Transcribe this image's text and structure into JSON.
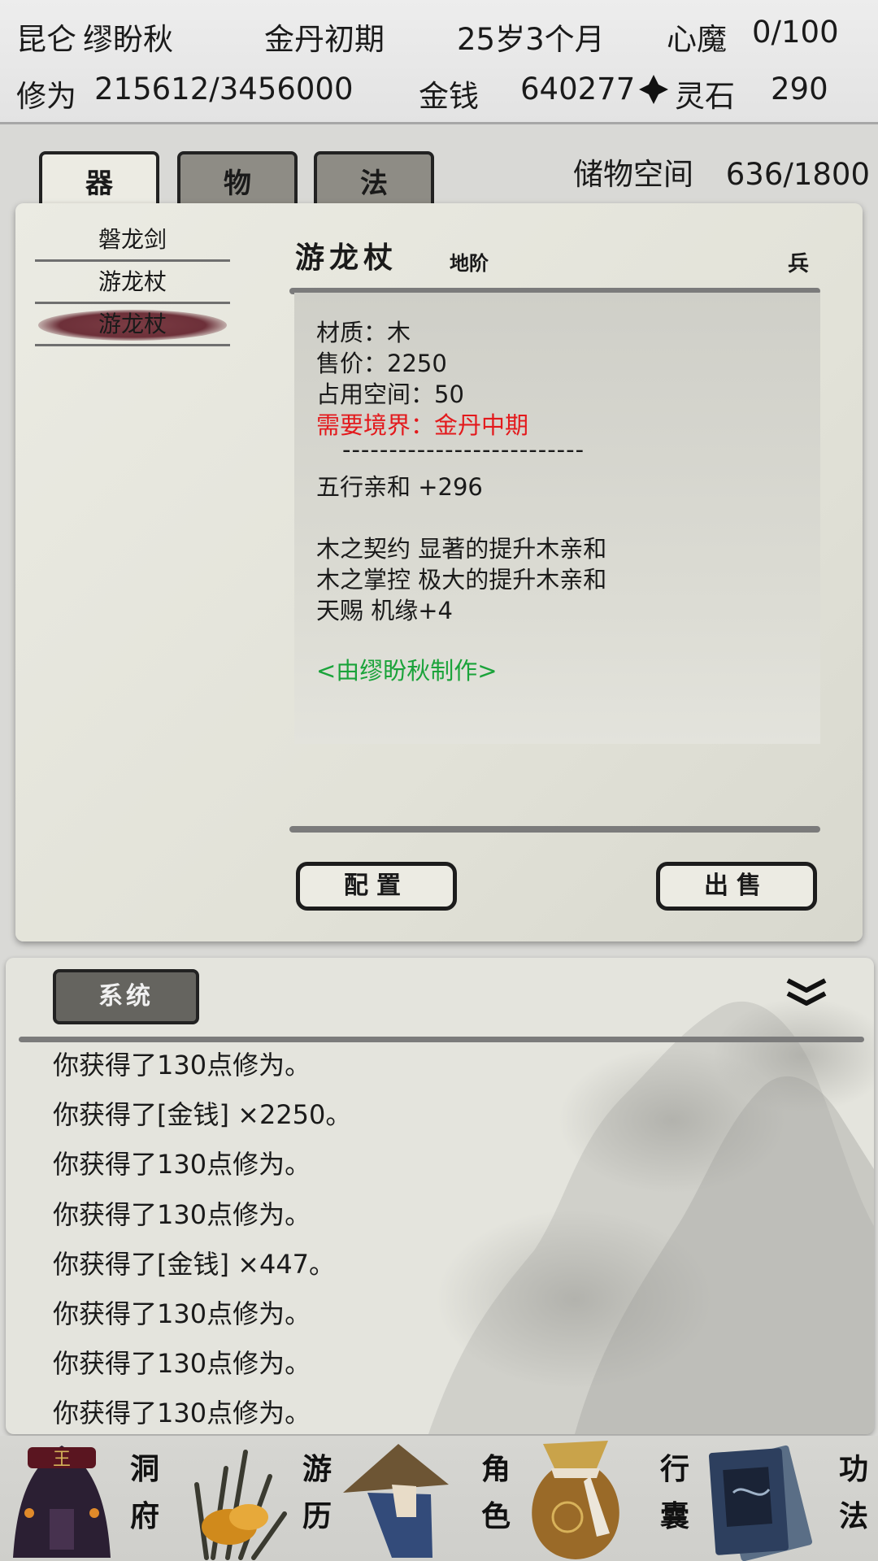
{
  "status": {
    "sect": "昆仑",
    "name": "缪盼秋",
    "realm": "金丹初期",
    "age": "25岁3个月",
    "heart_demon_label": "心魔",
    "heart_demon_value": "0/100",
    "cultivation_label": "修为",
    "cultivation_value": "215612/3456000",
    "money_label": "金钱",
    "money_value": "640277",
    "spirit_stone_label": "灵石",
    "spirit_stone_value": "290"
  },
  "bag": {
    "tabs": [
      "器",
      "物",
      "法"
    ],
    "active_tab": 0,
    "storage_label": "储物空间",
    "storage_value": "636/1800",
    "items": [
      "磐龙剑",
      "游龙杖",
      "游龙杖"
    ],
    "selected_item": 2
  },
  "detail": {
    "name": "游龙杖",
    "grade": "地阶",
    "type": "兵",
    "material": "材质：木",
    "price": "售价：2250",
    "space": "占用空间：50",
    "requirement": "需要境界：金丹中期",
    "divider": "--------------------------",
    "stat": "五行亲和 +296",
    "traits": [
      "木之契约 显著的提升木亲和",
      "木之掌控 极大的提升木亲和",
      "天赐 机缘+4"
    ],
    "maker": "<由缪盼秋制作>",
    "equip_button": "配置",
    "sell_button": "出售"
  },
  "log": {
    "tab_label": "系统",
    "lines": [
      "你获得了130点修为。",
      "你获得了[金钱] ×2250。",
      "你获得了130点修为。",
      "你获得了130点修为。",
      "你获得了[金钱] ×447。",
      "你获得了130点修为。",
      "你获得了130点修为。",
      "你获得了130点修为。"
    ]
  },
  "nav": {
    "items": [
      {
        "label": [
          "洞",
          "府"
        ],
        "icon": "cave-dwelling-icon"
      },
      {
        "label": [
          "游",
          "历"
        ],
        "icon": "travel-grass-icon"
      },
      {
        "label": [
          "角",
          "色"
        ],
        "icon": "character-hat-icon"
      },
      {
        "label": [
          "行",
          "囊"
        ],
        "icon": "bag-icon"
      },
      {
        "label": [
          "功",
          "法"
        ],
        "icon": "scripture-books-icon"
      }
    ]
  }
}
